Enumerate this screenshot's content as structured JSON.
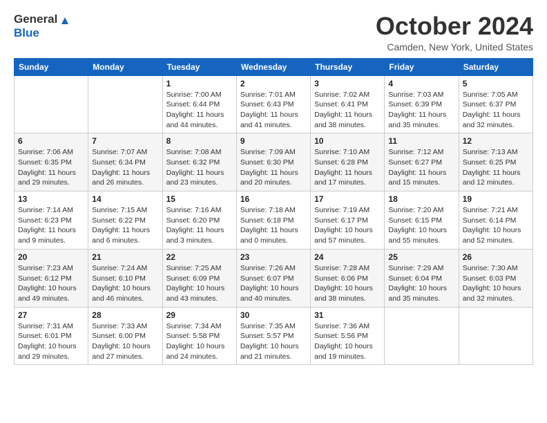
{
  "header": {
    "logo_text_general": "General",
    "logo_text_blue": "Blue",
    "month_title": "October 2024",
    "location": "Camden, New York, United States"
  },
  "weekdays": [
    "Sunday",
    "Monday",
    "Tuesday",
    "Wednesday",
    "Thursday",
    "Friday",
    "Saturday"
  ],
  "weeks": [
    [
      {
        "day": "",
        "sunrise": "",
        "sunset": "",
        "daylight": ""
      },
      {
        "day": "",
        "sunrise": "",
        "sunset": "",
        "daylight": ""
      },
      {
        "day": "1",
        "sunrise": "Sunrise: 7:00 AM",
        "sunset": "Sunset: 6:44 PM",
        "daylight": "Daylight: 11 hours and 44 minutes."
      },
      {
        "day": "2",
        "sunrise": "Sunrise: 7:01 AM",
        "sunset": "Sunset: 6:43 PM",
        "daylight": "Daylight: 11 hours and 41 minutes."
      },
      {
        "day": "3",
        "sunrise": "Sunrise: 7:02 AM",
        "sunset": "Sunset: 6:41 PM",
        "daylight": "Daylight: 11 hours and 38 minutes."
      },
      {
        "day": "4",
        "sunrise": "Sunrise: 7:03 AM",
        "sunset": "Sunset: 6:39 PM",
        "daylight": "Daylight: 11 hours and 35 minutes."
      },
      {
        "day": "5",
        "sunrise": "Sunrise: 7:05 AM",
        "sunset": "Sunset: 6:37 PM",
        "daylight": "Daylight: 11 hours and 32 minutes."
      }
    ],
    [
      {
        "day": "6",
        "sunrise": "Sunrise: 7:06 AM",
        "sunset": "Sunset: 6:35 PM",
        "daylight": "Daylight: 11 hours and 29 minutes."
      },
      {
        "day": "7",
        "sunrise": "Sunrise: 7:07 AM",
        "sunset": "Sunset: 6:34 PM",
        "daylight": "Daylight: 11 hours and 26 minutes."
      },
      {
        "day": "8",
        "sunrise": "Sunrise: 7:08 AM",
        "sunset": "Sunset: 6:32 PM",
        "daylight": "Daylight: 11 hours and 23 minutes."
      },
      {
        "day": "9",
        "sunrise": "Sunrise: 7:09 AM",
        "sunset": "Sunset: 6:30 PM",
        "daylight": "Daylight: 11 hours and 20 minutes."
      },
      {
        "day": "10",
        "sunrise": "Sunrise: 7:10 AM",
        "sunset": "Sunset: 6:28 PM",
        "daylight": "Daylight: 11 hours and 17 minutes."
      },
      {
        "day": "11",
        "sunrise": "Sunrise: 7:12 AM",
        "sunset": "Sunset: 6:27 PM",
        "daylight": "Daylight: 11 hours and 15 minutes."
      },
      {
        "day": "12",
        "sunrise": "Sunrise: 7:13 AM",
        "sunset": "Sunset: 6:25 PM",
        "daylight": "Daylight: 11 hours and 12 minutes."
      }
    ],
    [
      {
        "day": "13",
        "sunrise": "Sunrise: 7:14 AM",
        "sunset": "Sunset: 6:23 PM",
        "daylight": "Daylight: 11 hours and 9 minutes."
      },
      {
        "day": "14",
        "sunrise": "Sunrise: 7:15 AM",
        "sunset": "Sunset: 6:22 PM",
        "daylight": "Daylight: 11 hours and 6 minutes."
      },
      {
        "day": "15",
        "sunrise": "Sunrise: 7:16 AM",
        "sunset": "Sunset: 6:20 PM",
        "daylight": "Daylight: 11 hours and 3 minutes."
      },
      {
        "day": "16",
        "sunrise": "Sunrise: 7:18 AM",
        "sunset": "Sunset: 6:18 PM",
        "daylight": "Daylight: 11 hours and 0 minutes."
      },
      {
        "day": "17",
        "sunrise": "Sunrise: 7:19 AM",
        "sunset": "Sunset: 6:17 PM",
        "daylight": "Daylight: 10 hours and 57 minutes."
      },
      {
        "day": "18",
        "sunrise": "Sunrise: 7:20 AM",
        "sunset": "Sunset: 6:15 PM",
        "daylight": "Daylight: 10 hours and 55 minutes."
      },
      {
        "day": "19",
        "sunrise": "Sunrise: 7:21 AM",
        "sunset": "Sunset: 6:14 PM",
        "daylight": "Daylight: 10 hours and 52 minutes."
      }
    ],
    [
      {
        "day": "20",
        "sunrise": "Sunrise: 7:23 AM",
        "sunset": "Sunset: 6:12 PM",
        "daylight": "Daylight: 10 hours and 49 minutes."
      },
      {
        "day": "21",
        "sunrise": "Sunrise: 7:24 AM",
        "sunset": "Sunset: 6:10 PM",
        "daylight": "Daylight: 10 hours and 46 minutes."
      },
      {
        "day": "22",
        "sunrise": "Sunrise: 7:25 AM",
        "sunset": "Sunset: 6:09 PM",
        "daylight": "Daylight: 10 hours and 43 minutes."
      },
      {
        "day": "23",
        "sunrise": "Sunrise: 7:26 AM",
        "sunset": "Sunset: 6:07 PM",
        "daylight": "Daylight: 10 hours and 40 minutes."
      },
      {
        "day": "24",
        "sunrise": "Sunrise: 7:28 AM",
        "sunset": "Sunset: 6:06 PM",
        "daylight": "Daylight: 10 hours and 38 minutes."
      },
      {
        "day": "25",
        "sunrise": "Sunrise: 7:29 AM",
        "sunset": "Sunset: 6:04 PM",
        "daylight": "Daylight: 10 hours and 35 minutes."
      },
      {
        "day": "26",
        "sunrise": "Sunrise: 7:30 AM",
        "sunset": "Sunset: 6:03 PM",
        "daylight": "Daylight: 10 hours and 32 minutes."
      }
    ],
    [
      {
        "day": "27",
        "sunrise": "Sunrise: 7:31 AM",
        "sunset": "Sunset: 6:01 PM",
        "daylight": "Daylight: 10 hours and 29 minutes."
      },
      {
        "day": "28",
        "sunrise": "Sunrise: 7:33 AM",
        "sunset": "Sunset: 6:00 PM",
        "daylight": "Daylight: 10 hours and 27 minutes."
      },
      {
        "day": "29",
        "sunrise": "Sunrise: 7:34 AM",
        "sunset": "Sunset: 5:58 PM",
        "daylight": "Daylight: 10 hours and 24 minutes."
      },
      {
        "day": "30",
        "sunrise": "Sunrise: 7:35 AM",
        "sunset": "Sunset: 5:57 PM",
        "daylight": "Daylight: 10 hours and 21 minutes."
      },
      {
        "day": "31",
        "sunrise": "Sunrise: 7:36 AM",
        "sunset": "Sunset: 5:56 PM",
        "daylight": "Daylight: 10 hours and 19 minutes."
      },
      {
        "day": "",
        "sunrise": "",
        "sunset": "",
        "daylight": ""
      },
      {
        "day": "",
        "sunrise": "",
        "sunset": "",
        "daylight": ""
      }
    ]
  ]
}
